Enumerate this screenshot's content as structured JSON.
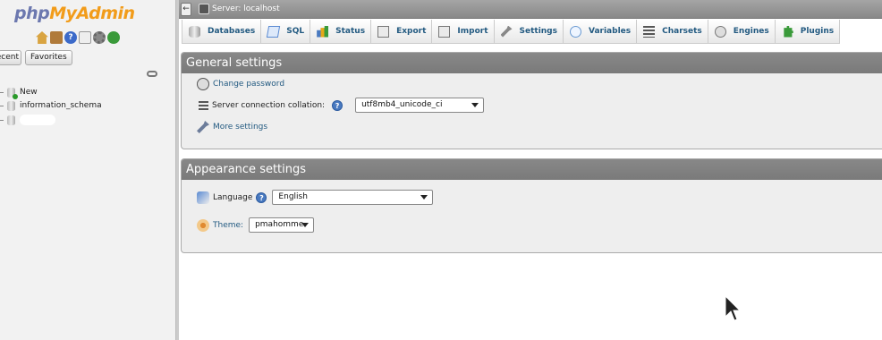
{
  "nav": {
    "logo_php": "php",
    "logo_myadmin": "MyAdmin",
    "icons": [
      "home-icon",
      "exit-icon",
      "help-icon",
      "docs-icon",
      "settings-gear-icon",
      "reload-icon"
    ],
    "recent_label": "Recent",
    "favorites_label": "Favorites",
    "tree": [
      {
        "label": "New"
      },
      {
        "label": "information_schema"
      }
    ]
  },
  "topbar": {
    "collapse_label": "←",
    "server_label": "Server: localhost"
  },
  "tabs": [
    {
      "label": "Databases",
      "icon": "database-icon"
    },
    {
      "label": "SQL",
      "icon": "sql-icon"
    },
    {
      "label": "Status",
      "icon": "status-icon"
    },
    {
      "label": "Export",
      "icon": "export-icon"
    },
    {
      "label": "Import",
      "icon": "import-icon"
    },
    {
      "label": "Settings",
      "icon": "wrench-icon"
    },
    {
      "label": "Variables",
      "icon": "variables-icon"
    },
    {
      "label": "Charsets",
      "icon": "charsets-icon"
    },
    {
      "label": "Engines",
      "icon": "engines-icon"
    },
    {
      "label": "Plugins",
      "icon": "plugin-icon"
    }
  ],
  "general": {
    "title": "General settings",
    "change_password": "Change password",
    "collation_label": "Server connection collation:",
    "collation_value": "utf8mb4_unicode_ci",
    "more_settings": "More settings"
  },
  "appearance": {
    "title": "Appearance settings",
    "language_label": "Language",
    "language_value": "English",
    "theme_label": "Theme:",
    "theme_value": "pmahomme"
  },
  "help_glyph": "?",
  "colors": {
    "link": "#235a81",
    "legend_bg": "#888888",
    "logo_php": "#6c78af",
    "logo_myadmin": "#f29c1a"
  }
}
